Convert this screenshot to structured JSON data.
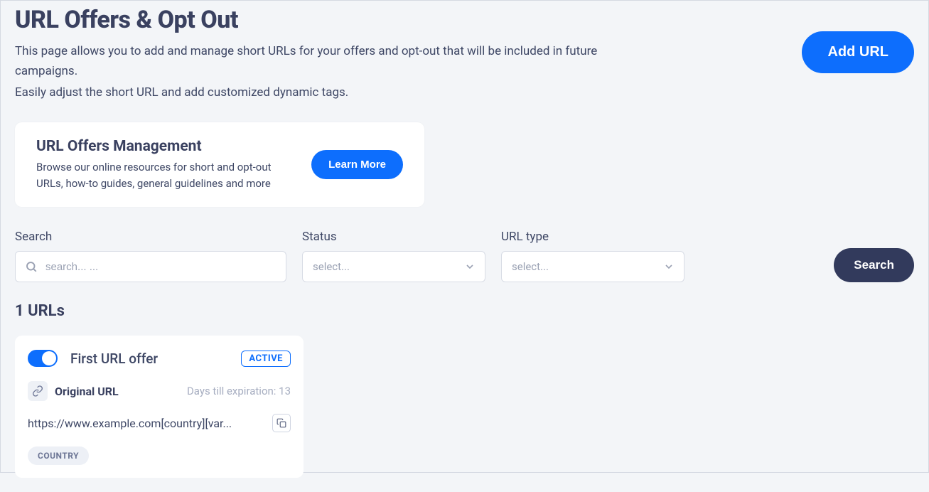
{
  "header": {
    "title": "URL Offers & Opt Out",
    "desc_line1": "This page allows you to add and manage short URLs for your offers and opt-out that will be included in future campaigns.",
    "desc_line2": "Easily adjust the short URL and add customized dynamic tags.",
    "add_url_label": "Add URL"
  },
  "info_card": {
    "title": "URL Offers Management",
    "text": "Browse our online resources for short and opt-out URLs, how-to guides, general guidelines and more",
    "learn_more_label": "Learn More"
  },
  "filters": {
    "search_label": "Search",
    "search_placeholder": "search... ...",
    "status_label": "Status",
    "status_placeholder": "select...",
    "urltype_label": "URL type",
    "urltype_placeholder": "select...",
    "search_button_label": "Search"
  },
  "list": {
    "count_heading": "1 URLs"
  },
  "card": {
    "title": "First URL offer",
    "status_badge": "ACTIVE",
    "original_url_label": "Original URL",
    "days_expiration": "Days till expiration: 13",
    "url_value": "https://www.example.com[country][var...",
    "tag": "COUNTRY"
  }
}
